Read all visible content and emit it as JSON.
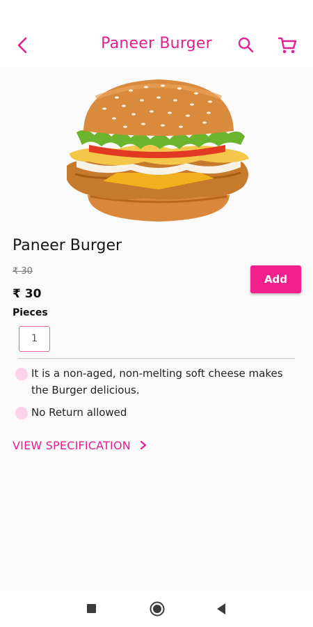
{
  "header": {
    "title": "Paneer Burger",
    "back_icon": "chevron-left-icon",
    "search_icon": "search-icon",
    "cart_icon": "cart-icon"
  },
  "product": {
    "image": "burger-photo",
    "name": "Paneer Burger",
    "old_price": "₹ 30",
    "price": "₹ 30",
    "pieces_label": "Pieces",
    "quantity": "1",
    "add_label": "Add"
  },
  "details": [
    {
      "text": "It is a non-aged, non-melting soft cheese makes the Burger delicious."
    },
    {
      "text": "No Return allowed"
    }
  ],
  "specification": {
    "label": "VIEW SPECIFICATION"
  },
  "colors": {
    "accent": "#e2208f",
    "button": "#f21f8c",
    "bullet": "#fbd2e8"
  }
}
